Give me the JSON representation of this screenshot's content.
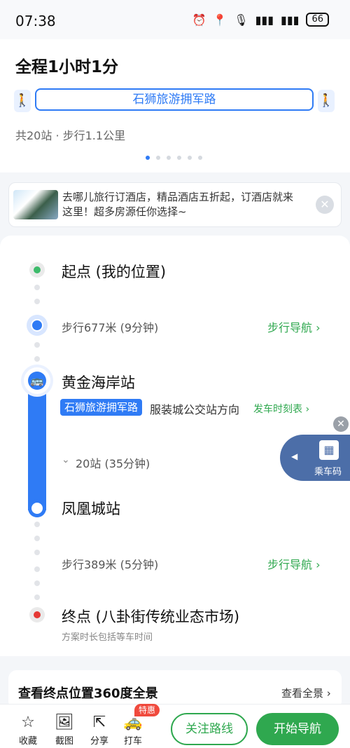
{
  "status_bar": {
    "time": "07:38",
    "icons": [
      "alarm-icon",
      "location-icon",
      "mic-icon",
      "signal-icon",
      "signal-wifi-icon"
    ],
    "battery": "66"
  },
  "header": {
    "duration": "全程1小时1分",
    "route_chip": "石狮旅游拥军路",
    "summary": "共20站 · 步行1.1公里",
    "page_dots": 6,
    "active_dot": 0
  },
  "ad": {
    "text": "去哪儿旅行订酒店，精品酒店五折起，订酒店就来这里！超多房源任你选择~",
    "close": "✕"
  },
  "route": {
    "start_title": "起点 (我的位置)",
    "walk1": "步行677米 (9分钟)",
    "walk1_nav": "步行导航 ›",
    "board_station": "黄金海岸站",
    "line_name": "石狮旅游拥军路",
    "direction": "服装城公交站方向",
    "timetable": "发车时刻表 ›",
    "stops": "20站 (35分钟)",
    "alight_station": "凤凰城站",
    "walk2": "步行389米 (5分钟)",
    "walk2_nav": "步行导航 ›",
    "end_title": "终点 (八卦街传统业态市场)",
    "note": "方案时长包括等车时间"
  },
  "floating_qr": {
    "label": "乘车码",
    "close": "✕"
  },
  "panorama": {
    "title": "查看终点位置360度全景",
    "link": "查看全景 ›"
  },
  "bottom_bar": {
    "favorite": "收藏",
    "screenshot": "截图",
    "share": "分享",
    "taxi": "打车",
    "taxi_badge": "特惠",
    "follow": "关注路线",
    "start": "开始导航"
  },
  "colors": {
    "accent_blue": "#2f7bf5",
    "accent_green": "#2fa84f",
    "start_green": "#3dbb6b",
    "end_red": "#e53935"
  }
}
